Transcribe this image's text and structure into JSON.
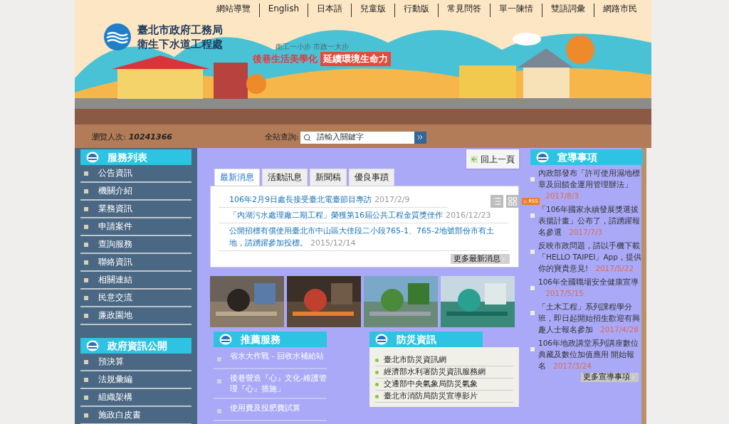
{
  "top_nav": [
    "網站導覽",
    "English",
    "日本語",
    "兒童版",
    "行動版",
    "常見問答",
    "單一陳情",
    "雙語詞彙",
    "網路市民"
  ],
  "logo": {
    "line1": "臺北市政府工務局",
    "line2": "衛生下水道工程處"
  },
  "slogan": {
    "small": "衛工一小步 市政一大步",
    "main": "後巷生活美學化",
    "highlight": "延續環境生命力"
  },
  "visits": {
    "label": "瀏覽人次:",
    "value": "10241366"
  },
  "search": {
    "label": "全站查詢:",
    "placeholder": "請輸入關鍵字"
  },
  "sidebar": [
    {
      "title": "服務列表",
      "items": [
        "公告資訊",
        "機關介紹",
        "業務資訊",
        "申請案件",
        "查詢服務",
        "聯絡資訊",
        "相關連結",
        "民意交流",
        "廉政園地"
      ]
    },
    {
      "title": "政府資訊公開",
      "items": [
        "預決算",
        "法規彙編",
        "組織架構",
        "施政白皮書"
      ]
    }
  ],
  "back_button": "回上一頁",
  "tabs": [
    {
      "label": "最新消息",
      "selected": true
    },
    {
      "label": "活動訊息",
      "selected": false
    },
    {
      "label": "新聞稿",
      "selected": false
    },
    {
      "label": "優良事蹟",
      "selected": false
    }
  ],
  "news": [
    {
      "title": "106年2月9日處長接受臺北電臺節目專訪",
      "date": "2017/2/9"
    },
    {
      "title": "「內湖污水處理廠二期工程」榮獲第16屆公共工程金質獎佳作",
      "date": "2016/12/23"
    },
    {
      "title": "公開招標有償使用臺北市中山區大佳段二小段765-1、765-2地號部份市有土地，請踴躍參加投標。",
      "date": "2015/12/14"
    }
  ],
  "rss": "RSS",
  "more_news": "更多最新消息",
  "recommended": {
    "title": "推薦服務",
    "items": [
      "省水大作戰 - 回收水補給站",
      "後巷營造『心』文化-維護管理『心』措施」",
      "使用費及投肥費試算"
    ]
  },
  "disaster": {
    "title": "防災資訊",
    "items": [
      "臺北市防災資訊網",
      "經濟部水利署防災資訊服務網",
      "交通部中央氣象局防災氣象",
      "臺北市消防局防災宣導影片"
    ]
  },
  "announcements": {
    "title": "宣導事項",
    "items": [
      {
        "text": "內政部發布「許可使用濕地標章及回饋金運用管理辦法」",
        "date": "2017/8/3"
      },
      {
        "text": "「106年國家永續發展獎選拔表揚計畫」公布了，請踴躍報名參選",
        "date": "2017/7/3"
      },
      {
        "text": "反映市政問題，請以手機下載「HELLO TAIPEI」App，提供你的寶貴意見!",
        "date": "2017/5/22"
      },
      {
        "text": "106年全國職場安全健康宣導",
        "date": "2017/5/15"
      },
      {
        "text": "「土木工程」系列課程學分班，即日起開始招生歡迎有興趣人士報名參加",
        "date": "2017/4/28"
      },
      {
        "text": "106年地政講堂系列講座數位典藏及數位加值應用 開始報名",
        "date": "2017/3/24"
      }
    ],
    "more": "更多宣導事項"
  }
}
